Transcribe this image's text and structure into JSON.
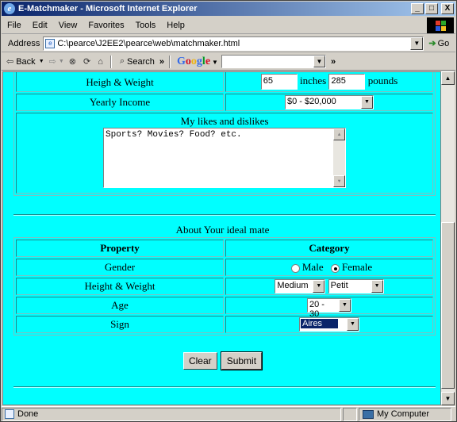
{
  "window": {
    "title": "E-Matchmaker - Microsoft Internet Explorer",
    "min": "_",
    "max": "□",
    "close": "X"
  },
  "menu": [
    "File",
    "Edit",
    "View",
    "Favorites",
    "Tools",
    "Help"
  ],
  "address": {
    "label": "Address",
    "url": "C:\\pearce\\J2EE2\\pearce\\web\\matchmaker.html",
    "go": "Go"
  },
  "toolbar": {
    "back": "Back",
    "search": "Search",
    "google_search_value": ""
  },
  "status": {
    "text": "Done",
    "zone": "My Computer"
  },
  "form1": {
    "height_weight_label": "Heigh & Weight",
    "height_value": "65",
    "inches_label": "inches",
    "weight_value": "285",
    "pounds_label": "pounds",
    "income_label": "Yearly Income",
    "income_value": "$0 - $20,000",
    "likes_label": "My likes and dislikes",
    "likes_value": "Sports? Movies? Food? etc."
  },
  "about_heading": "About Your ideal mate",
  "form2": {
    "col_property": "Property",
    "col_category": "Category",
    "gender_label": "Gender",
    "gender_options": [
      "Male",
      "Female"
    ],
    "gender_selected": "Female",
    "hw_label": "Height & Weight",
    "height_value": "Medium",
    "weight_value": "Petit",
    "age_label": "Age",
    "age_value": "20 - 30",
    "sign_label": "Sign",
    "sign_value": "Aires"
  },
  "buttons": {
    "clear": "Clear",
    "submit": "Submit"
  },
  "colors": {
    "page_bg": "#00ffff",
    "title_start": "#0a246a",
    "title_end": "#a6caf0"
  }
}
